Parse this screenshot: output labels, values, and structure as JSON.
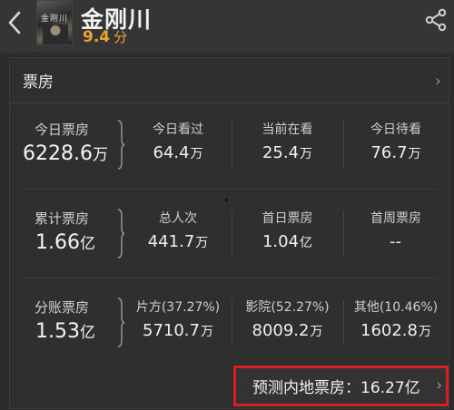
{
  "header": {
    "back_icon": "chevron-left-icon",
    "poster_icon": "movie-poster",
    "poster_text": "金刚川",
    "title": "金刚川",
    "rating": "9.4",
    "rating_unit": "分",
    "share_icon": "share-icon",
    "rating_color": "#f0a52a"
  },
  "box_office": {
    "section_title": "票房",
    "chevron": "›",
    "today": {
      "label": "今日票房",
      "value": "6228.6",
      "unit": "万",
      "items": [
        {
          "label": "今日看过",
          "value": "64.4",
          "unit": "万"
        },
        {
          "label": "当前在看",
          "value": "25.4",
          "unit": "万"
        },
        {
          "label": "今日待看",
          "value": "76.7",
          "unit": "万"
        }
      ]
    },
    "cumulative": {
      "label": "累计票房",
      "value": "1.66",
      "unit": "亿",
      "items": [
        {
          "label": "总人次",
          "value": "441.7",
          "unit": "万"
        },
        {
          "label": "首日票房",
          "value": "1.04",
          "unit": "亿"
        },
        {
          "label": "首周票房",
          "value": "--",
          "unit": ""
        }
      ]
    },
    "split": {
      "label": "分账票房",
      "value": "1.53",
      "unit": "亿",
      "items": [
        {
          "label": "片方(37.27%)",
          "value": "5710.7",
          "unit": "万"
        },
        {
          "label": "影院(52.27%)",
          "value": "8009.2",
          "unit": "万"
        },
        {
          "label": "其他(10.46%)",
          "value": "1602.8",
          "unit": "万"
        }
      ]
    },
    "forecast": {
      "label": "预测内地票房：16.27亿",
      "chevron": "›",
      "highlight_color": "#d42020"
    }
  }
}
